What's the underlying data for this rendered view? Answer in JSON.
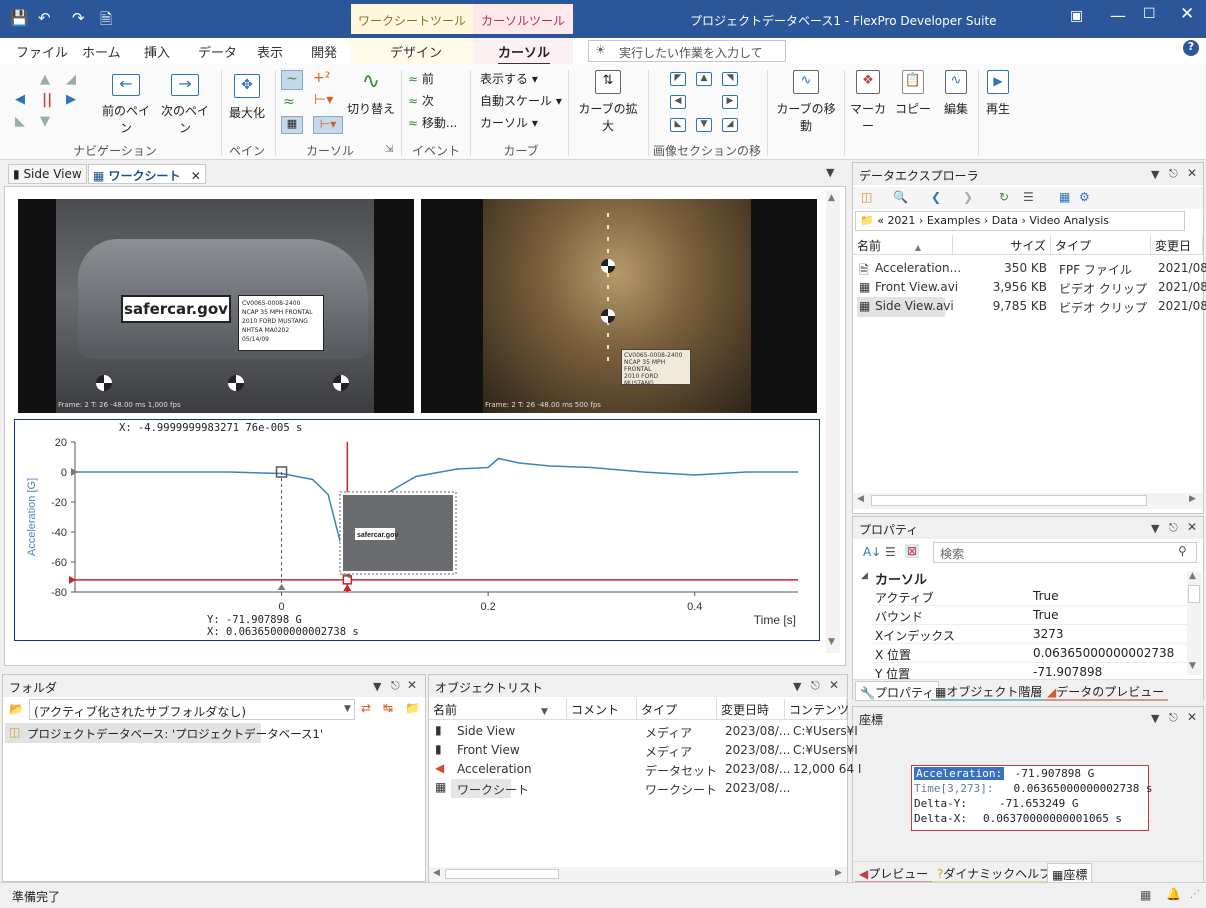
{
  "titlebar": {
    "title": "プロジェクトデータベース1 - FlexPro Developer Suite",
    "ctx_worksheet": "ワークシートツール",
    "ctx_cursor": "カーソルツール"
  },
  "tabs": [
    "ファイル",
    "ホーム",
    "挿入",
    "データ",
    "表示",
    "開発",
    "デザイン",
    "カーソル"
  ],
  "search_placeholder": "実行したい作業を入力してく...",
  "ribbon": {
    "prev_pane": "前のペイン",
    "next_pane": "次のペイン",
    "maximize": "最大化",
    "switch": "切り替え",
    "prev": "前",
    "next": "次",
    "move": "移動...",
    "show": "表示する",
    "autoscale": "自動スケール",
    "cursor_menu": "カーソル",
    "curve_zoom": "カーブの拡大",
    "curve_move": "カーブの移動",
    "marker": "マーカー",
    "copy": "コピー",
    "edit": "編集",
    "play": "再生",
    "g_nav": "ナビゲーション",
    "g_pane": "ペイン",
    "g_cursor": "カーソル",
    "g_event": "イベント",
    "g_curve": "カーブ",
    "g_imgmove": "画像セクションの移動"
  },
  "doc_tabs": {
    "side": "Side View",
    "worksheet": "ワークシート"
  },
  "video": {
    "left_caption": "Frame: 2   T: 26  -48.00 ms  1,000 fps",
    "right_caption": "Frame: 2   T: 26  -48.00 ms  500 fps",
    "brand": "safercar.gov",
    "placard": [
      "CV0065-0008-2400",
      "NCAP 35 MPH FRONTAL",
      "2010 FORD MUSTANG",
      "NHTSA MA0202",
      "05/14/09"
    ]
  },
  "chart_data": {
    "type": "line",
    "ylabel": "Acceleration [G]",
    "xlabel": "Time [s]",
    "xlim": [
      -0.2,
      0.5
    ],
    "ylim": [
      -80,
      20
    ],
    "xticks": [
      "0",
      "0.2",
      "0.4"
    ],
    "yticks": [
      "20",
      "0",
      "-20",
      "-40",
      "-60",
      "-80"
    ],
    "series": [
      {
        "name": "Acceleration",
        "color": "#3b82c4",
        "points": [
          [
            -0.2,
            0
          ],
          [
            -0.15,
            0
          ],
          [
            -0.05,
            0
          ],
          [
            0,
            -1
          ],
          [
            0.03,
            -5
          ],
          [
            0.045,
            -15
          ],
          [
            0.06,
            -55
          ],
          [
            0.0637,
            -72
          ],
          [
            0.07,
            -60
          ],
          [
            0.08,
            -38
          ],
          [
            0.1,
            -15
          ],
          [
            0.13,
            -3
          ],
          [
            0.17,
            2
          ],
          [
            0.2,
            3
          ],
          [
            0.21,
            9
          ],
          [
            0.23,
            6
          ],
          [
            0.26,
            4
          ],
          [
            0.3,
            3
          ],
          [
            0.35,
            0
          ],
          [
            0.4,
            -2
          ],
          [
            0.45,
            0
          ],
          [
            0.5,
            0
          ]
        ]
      }
    ],
    "cursor_x_label": "X: -4.9999999983271 76e-005 s",
    "cursor_y_label": "Y: -71.907898 G",
    "cursor_x2_label": "X: 0.06365000000002738 s",
    "cursor1_x": -5e-05,
    "cursor2_x": 0.06365,
    "cursor2_y": -71.907898
  },
  "explorer": {
    "title": "データエクスプローラ",
    "crumb": [
      "«",
      "2021",
      "Examples",
      "Data",
      "Video Analysis"
    ],
    "headers": [
      "名前",
      "サイズ",
      "タイプ",
      "変更日"
    ],
    "rows": [
      {
        "name": "Acceleration...",
        "size": "350 KB",
        "type": "FPF ファイル",
        "date": "2021/08/"
      },
      {
        "name": "Front View.avi",
        "size": "3,956 KB",
        "type": "ビデオ クリップ",
        "date": "2021/08/"
      },
      {
        "name": "Side View.avi",
        "size": "9,785 KB",
        "type": "ビデオ クリップ",
        "date": "2021/08/"
      }
    ]
  },
  "properties": {
    "title": "プロパティ",
    "search": "検索",
    "section": "カーソル",
    "rows": [
      {
        "k": "アクティブ",
        "v": "True"
      },
      {
        "k": "バウンド",
        "v": "True"
      },
      {
        "k": "Xインデックス",
        "v": "3273"
      },
      {
        "k": "X 位置",
        "v": "0.06365000000002738"
      },
      {
        "k": "Y 位置",
        "v": "-71.907898"
      }
    ],
    "tabs": [
      "プロパティ",
      "オブジェクト階層",
      "データのプレビュー"
    ]
  },
  "coords": {
    "title": "座標",
    "rows": [
      {
        "k": "Acceleration:",
        "v": "-71.907898 G"
      },
      {
        "k": "Time[3,273]:",
        "v": "0.06365000000002738 s"
      },
      {
        "k": "Delta-Y:",
        "v": "-71.653249 G"
      },
      {
        "k": "Delta-X:",
        "v": "0.06370000000001065 s"
      }
    ],
    "tabs": [
      "プレビュー",
      "ダイナミックヘルプ",
      "座標"
    ]
  },
  "folder": {
    "title": "フォルダ",
    "combo": "(アクティブ化されたサブフォルダなし)",
    "item": "プロジェクトデータベース: 'プロジェクトデータベース1'"
  },
  "objlist": {
    "title": "オブジェクトリスト",
    "headers": [
      "名前",
      "コメント",
      "タイプ",
      "変更日時",
      "コンテンツ"
    ],
    "rows": [
      {
        "name": "Side View",
        "type": "メディア",
        "date": "2023/08/...",
        "content": "C:¥Users¥I"
      },
      {
        "name": "Front View",
        "type": "メディア",
        "date": "2023/08/...",
        "content": "C:¥Users¥I"
      },
      {
        "name": "Acceleration",
        "type": "データセット",
        "date": "2023/08/...",
        "content": "12,000 64 I"
      },
      {
        "name": "ワークシート",
        "type": "ワークシート",
        "date": "2023/08/...",
        "content": ""
      }
    ]
  },
  "status": "準備完了"
}
